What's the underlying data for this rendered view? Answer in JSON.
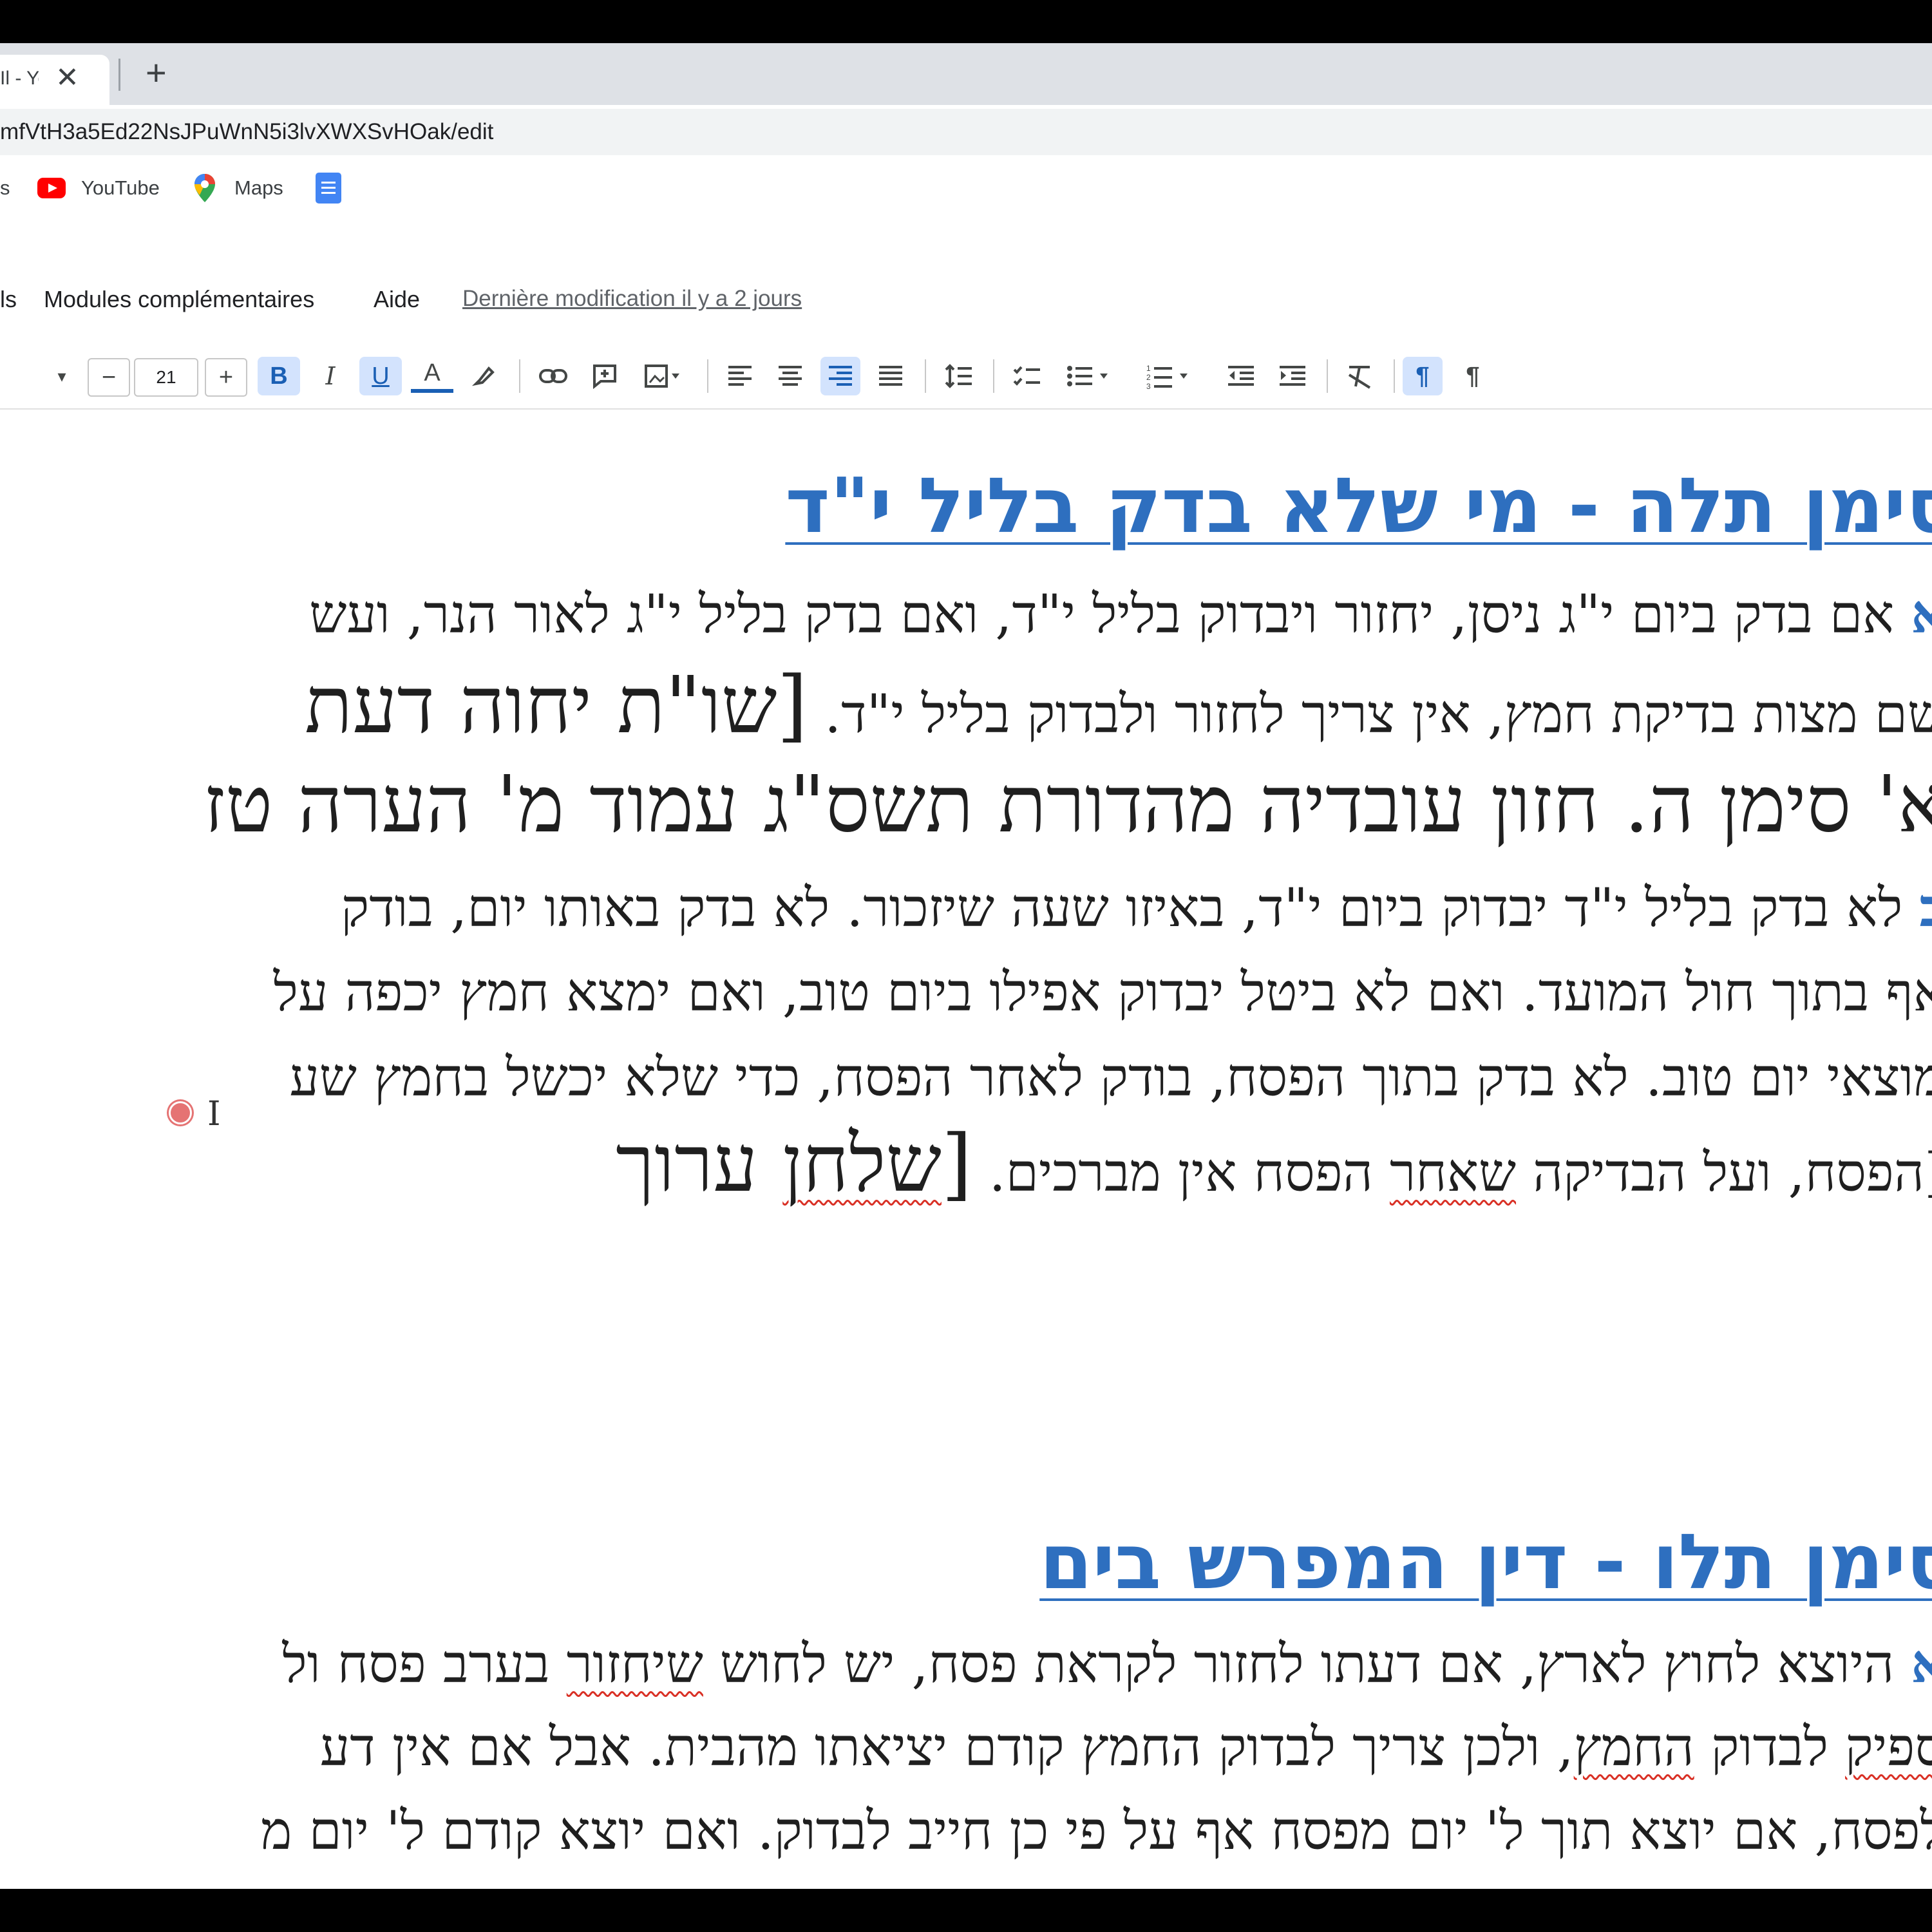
{
  "browser": {
    "tab_title": "Il - You",
    "tab_close": "✕",
    "new_tab": "+",
    "url": "mfVtH3a5Ed22NsJPuWnN5i3lvXWXSvHOak/edit"
  },
  "bookmarks": {
    "prev_fragment": "s",
    "youtube": "YouTube",
    "maps": "Maps"
  },
  "menubar": {
    "prev_fragment": "ls",
    "modules": "Modules complémentaires",
    "aide": "Aide",
    "last_edit": "Dernière modification il y a 2 jours"
  },
  "toolbar": {
    "font_size": "21",
    "minus": "−",
    "plus": "+",
    "bold": "B",
    "italic": "I",
    "underline": "U",
    "text_color": "A"
  },
  "document": {
    "heading1": "סימן תלה - מי שלא בדק בליל י\"ד",
    "line1_mark": "א",
    "line1": " אם בדק ביום י\"ג ניסן, יחזור ויבדוק בליל י\"ד, ואם בדק בליל י\"ג לאור הנר, ועש",
    "line2_main": "שם מצות בדיקת חמץ, אין צריך לחזור ולבדוק בליל י\"ד. ",
    "line2_large": "[שו\"ת יחוה דעת",
    "line3": "א' סימן ה. חזון עובדיה מהדורת תשס\"ג עמוד מ' הערה טז",
    "line4_mark": "ב",
    "line4": " לא בדק בליל י\"ד יבדוק ביום י\"ד, באיזו שעה שיזכור. לא בדק באותו יום, בודק",
    "line5": "אף בתוך חול המועד. ואם לא ביטל יבדוק אפילו ביום טוב, ואם ימצא חמץ יכפה על",
    "line6": "מוצאי יום טוב. לא בדק בתוך הפסח, בודק לאחר הפסח, כדי שלא יכשל בחמץ שע",
    "line7_pre": "[הפסח, ועל הבדיקה ",
    "line7_sq": "שאחר",
    "line7_mid": " הפסח אין מברכים. ",
    "line7_large_pre": "[",
    "line7_large_sq": "שלחן",
    "line7_large_post": " ערוך",
    "heading2": "סימן תלו - דין המפרש בים",
    "line8_mark": "א",
    "line8_pre": " היוצא לחוץ לארץ, אם דעתו לחזור לקראת פסח, יש לחוש ",
    "line8_sq": "שיחזור",
    "line8_post": " בערב פסח ול",
    "line9_pre": "ספיק",
    "line9_mid1": " לבדוק ",
    "line9_sq": "החמץ",
    "line9_post": ", ולכן צריך לבדוק החמץ קודם יציאתו מהבית. אבל אם אין דע",
    "line10": "לפסח, אם יוצא תוך ל' יום מפסח אף על פי כן חייב לבדוק. ואם יוצא קודם ל' יום מ"
  },
  "colors": {
    "heading": "#2e6fbf",
    "squiggle": "#d93025",
    "toolbar_active": "#d3e3fd"
  }
}
